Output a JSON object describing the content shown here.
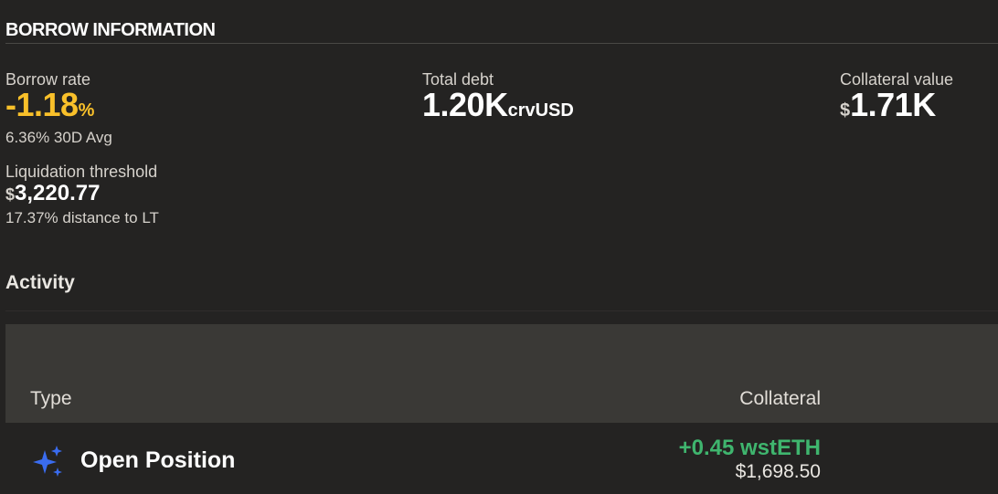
{
  "header": {
    "title": "BORROW INFORMATION"
  },
  "stats": {
    "borrow_rate": {
      "label": "Borrow rate",
      "value": "-1.18",
      "unit": "%",
      "sub": "6.36% 30D Avg"
    },
    "total_debt": {
      "label": "Total debt",
      "value": "1.20K",
      "unit": "crvUSD"
    },
    "collateral_value": {
      "label": "Collateral value",
      "currency": "$",
      "value": "1.71K"
    },
    "liquidation_threshold": {
      "label": "Liquidation threshold",
      "currency": "$",
      "value": "3,220.77",
      "sub": "17.37% distance to LT"
    }
  },
  "activity": {
    "title": "Activity",
    "columns": {
      "type": "Type",
      "collateral": "Collateral"
    },
    "rows": [
      {
        "icon": "sparkles-icon",
        "type": "Open Position",
        "amount": "+0.45 wstETH",
        "usd": "$1,698.50"
      }
    ]
  },
  "colors": {
    "background": "#242322",
    "accent_rate": "#f9c02a",
    "positive": "#3fb56e",
    "icon": "#3a6cf0",
    "table_header": "#3a3936"
  }
}
